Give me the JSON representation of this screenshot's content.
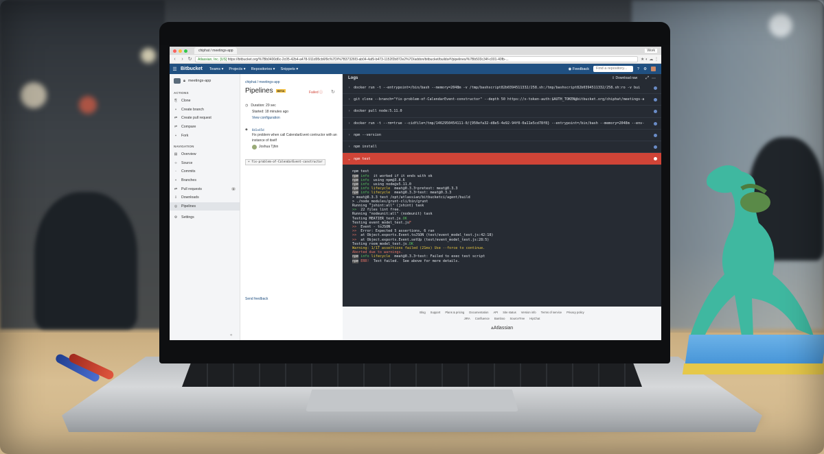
{
  "browser": {
    "tab_title": "chiphat / meetings-app",
    "profile": "Work",
    "url_secure": "Atlassian, Inc. [US]",
    "url": "https://bitbucket.org/%7Bb0400d6c-2c05-42b4-a478-911d95cb6f9c%7D/%7B37326f3-ab04-4af9-b473-1152f2b872e2%7D/addon/bitbucket/builds#!/pipelines/%7Bb503c34f-c001-40fb-..."
  },
  "nav": {
    "logo": "Bitbucket",
    "menus": [
      "Teams ▾",
      "Projects ▾",
      "Repositories ▾",
      "Snippets ▾"
    ],
    "feedback": "Feedback",
    "search_placeholder": "Find a repository..."
  },
  "sidebar": {
    "repo_name": "meetings-app",
    "actions_heading": "ACTIONS",
    "actions": [
      {
        "label": "Clone",
        "icon": "clone-icon"
      },
      {
        "label": "Create branch",
        "icon": "branch-icon"
      },
      {
        "label": "Create pull request",
        "icon": "pull-request-icon"
      },
      {
        "label": "Compare",
        "icon": "compare-icon"
      },
      {
        "label": "Fork",
        "icon": "fork-icon"
      }
    ],
    "navigation_heading": "NAVIGATION",
    "navigation": [
      {
        "label": "Overview",
        "icon": "overview-icon"
      },
      {
        "label": "Source",
        "icon": "source-icon"
      },
      {
        "label": "Commits",
        "icon": "commits-icon"
      },
      {
        "label": "Branches",
        "icon": "branches-icon"
      },
      {
        "label": "Pull requests",
        "icon": "pull-requests-icon",
        "badge": "3"
      },
      {
        "label": "Downloads",
        "icon": "downloads-icon"
      },
      {
        "label": "Pipelines",
        "icon": "pipelines-icon",
        "active": true
      }
    ],
    "settings": "Settings",
    "collapse": "«"
  },
  "pipeline": {
    "breadcrumb": "chiphat  /  meetings-app",
    "title": "Pipelines",
    "beta": "BETA",
    "status": "Failed",
    "duration": "Duration: 29 sec",
    "started": "Started: 18 minutes ago",
    "view_config": "View configuration",
    "commit_hash": "8d1e45d",
    "commit_message": "Fix problem when call CalendarEvent contructor with an instance of itself",
    "author": "Joshua Tjhin",
    "branch": "fix-problem-of-CalendarEvent-constructor",
    "send_feedback": "Send feedback"
  },
  "logs": {
    "heading": "Logs",
    "download": "Download raw",
    "commands": [
      "docker run -t --entrypoint=/bin/bash --memory=2048m -v /tmp/bashscript82b0394511332/258.sh:/tmp/bashscript82b0394511332/258.sh:ro -v bui",
      "git clone --branch=\"fix-problem-of-CalendarEvent-constructor\" --depth 50 https://x-token-auth:$AUTH_TOKEN@bitbucket.org/chiphat/meetings-a",
      "docker pull node:5.11.0",
      "docker run -t --rm=true --cidfile=/tmp/1462950454111-0/{950efa32-d8e5-4e92-94f0-0a11e5cd78f8} --entrypoint=/bin/bash --memory=2048m --env-",
      "npm --version",
      "npm install"
    ],
    "failed_command": "npm test",
    "output": [
      {
        "t": "npm test"
      },
      {
        "m": "npm",
        "g": "info",
        "t": " it worked if it ends with ok"
      },
      {
        "m": "npm",
        "g": "info",
        "t": " using npm@3.8.6"
      },
      {
        "m": "npm",
        "g": "info",
        "t": " using node@v5.11.0"
      },
      {
        "m": "npm",
        "g": "info",
        "y": "lifecycle",
        "t": " meat@0.3.3~pretest: meat@0.3.3"
      },
      {
        "t": ""
      },
      {
        "m": "npm",
        "g": "info",
        "y": "lifecycle",
        "t": " meat@0.3.3~test: meat@0.3.3"
      },
      {
        "t": ""
      },
      {
        "t": "> meat@0.3.3 test /opt/atlassian/bitbucketci/agent/build"
      },
      {
        "t": "> ./node_modules/grunt-cli/bin/grunt"
      },
      {
        "t": ""
      },
      {
        "t": "Running \"jshint:all\" (jshint) task"
      },
      {
        "g": ">>",
        "t": " 22 files lint free."
      },
      {
        "t": ""
      },
      {
        "t": "Running \"nodeunit:all\" (nodeunit) task"
      },
      {
        "t": "Testing MEATIER_test.js",
        "g2": ".OK"
      },
      {
        "t": "Testing event_model_test.js",
        "r2": "F"
      },
      {
        "r": ">>",
        "t": " Event - toJSON"
      },
      {
        "r": ">>",
        "t": " Error: Expected 5 assertions, 6 ran"
      },
      {
        "r": ">>",
        "t": " at Object.exports.Event.toJSON (test/event_model_test.js:42:18)"
      },
      {
        "r": ">>",
        "t": " at Object.exports.Event.setUp (test/event_model_test.js:28:5)"
      },
      {
        "t": ""
      },
      {
        "t": "Testing room_model_test.js",
        "g2": ".OK"
      },
      {
        "yl": "Warning: 1/17 assertions failed (21ms) Use --force to continue."
      },
      {
        "t": ""
      },
      {
        "rl": "Aborted due to warnings."
      },
      {
        "t": ""
      },
      {
        "m": "npm",
        "g": "info",
        "y": "lifecycle",
        "t": " meat@0.3.3~test: Failed to exec test script"
      },
      {
        "m": "npm",
        "r": "ERR!",
        "t": " Test failed.  See above for more details."
      }
    ]
  },
  "footer": {
    "links_row1": [
      "Blog",
      "Support",
      "Plans & pricing",
      "Documentation",
      "API",
      "Site status",
      "Version info",
      "Terms of service",
      "Privacy policy"
    ],
    "links_row2": [
      "JIRA",
      "Confluence",
      "Bamboo",
      "SourceTree",
      "HipChat"
    ],
    "brand": "Atlassian"
  },
  "colors": {
    "bitbucket_blue": "#205081",
    "error_red": "#d04437",
    "log_bg": "#262b33"
  }
}
